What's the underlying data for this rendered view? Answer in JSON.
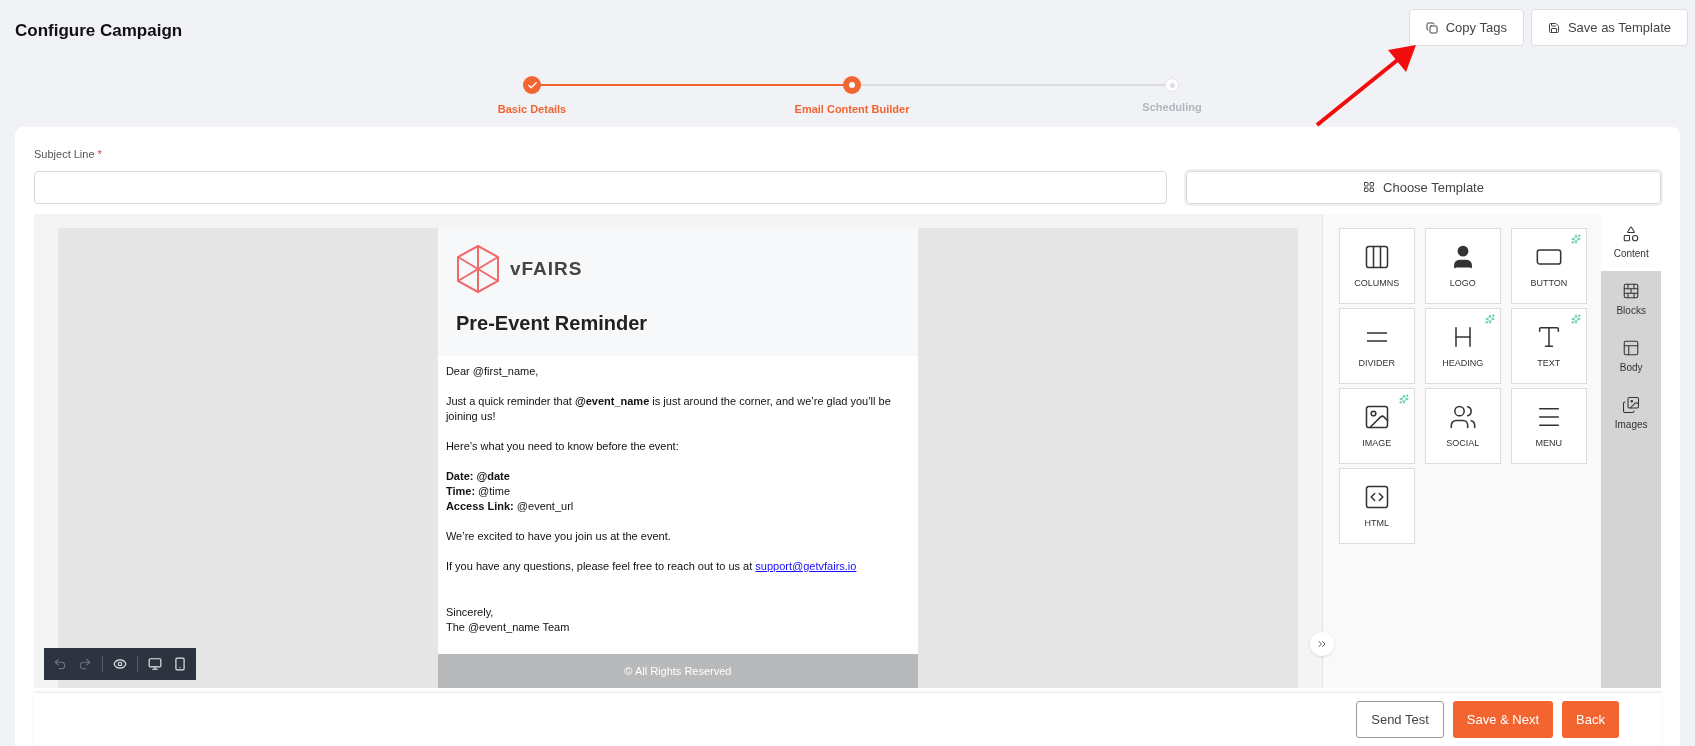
{
  "page_title": "Configure Campaign",
  "header_buttons": [
    {
      "label": "Copy Tags"
    },
    {
      "label": "Save as Template"
    }
  ],
  "steps": [
    {
      "label": "Basic Details",
      "done": true,
      "current": false
    },
    {
      "label": "Email Content Builder",
      "done": false,
      "current": true
    },
    {
      "label": "Scheduling",
      "done": false,
      "current": false
    }
  ],
  "subject": {
    "label": "Subject Line",
    "required_mark": "*"
  },
  "choose_template": "Choose Template",
  "email": {
    "brand": "vFAIRS",
    "title": "Pre-Event Reminder",
    "blocks": [
      {
        "kind": "para",
        "lines": [
          {
            "text": "Dear @first_name,"
          }
        ]
      },
      {
        "kind": "para",
        "lines": [
          {
            "text": "Just a quick reminder that **@event_name** is just around the corner, and we’re glad you’ll be joining us!"
          }
        ]
      },
      {
        "kind": "para",
        "lines": [
          {
            "text": "Here’s what you need to know before the event:"
          }
        ]
      },
      {
        "kind": "para",
        "lines": [
          {
            "text": "**Date: @date**"
          },
          {
            "text": "**Time:** @time"
          },
          {
            "text": "**Access Link:** @event_url"
          }
        ]
      },
      {
        "kind": "para",
        "lines": [
          {
            "text": "We’re excited to have you join us at the event."
          }
        ]
      },
      {
        "kind": "para",
        "lines": [
          {
            "text": "If you have any questions, please feel free to reach out to us at",
            "link": "support@getvfairs.io"
          }
        ]
      },
      {
        "kind": "closing",
        "lines": [
          {
            "text": "Sincerely,"
          },
          {
            "text": "The @event_name Team"
          }
        ]
      }
    ],
    "footer": "© All Rights Reserved"
  },
  "toolbar": [
    {
      "disabled": true
    },
    {
      "disabled": true
    },
    {
      "disabled": false
    },
    {
      "disabled": false
    },
    {
      "disabled": false
    }
  ],
  "tiles": [
    {
      "label": "COLUMNS",
      "ai": false
    },
    {
      "label": "LOGO",
      "ai": false
    },
    {
      "label": "BUTTON",
      "ai": true
    },
    {
      "label": "DIVIDER",
      "ai": false
    },
    {
      "label": "HEADING",
      "ai": true
    },
    {
      "label": "TEXT",
      "ai": true
    },
    {
      "label": "IMAGE",
      "ai": true
    },
    {
      "label": "SOCIAL",
      "ai": false
    },
    {
      "label": "MENU",
      "ai": false
    },
    {
      "label": "HTML",
      "ai": false
    }
  ],
  "side_tabs": [
    {
      "label": "Content",
      "selected": true
    },
    {
      "label": "Blocks",
      "selected": false
    },
    {
      "label": "Body",
      "selected": false
    },
    {
      "label": "Images",
      "selected": false
    }
  ],
  "footer_buttons": [
    {
      "label": "Send Test",
      "kind": "outline"
    },
    {
      "label": "Save & Next",
      "kind": "primary"
    },
    {
      "label": "Back",
      "kind": "primary"
    }
  ]
}
